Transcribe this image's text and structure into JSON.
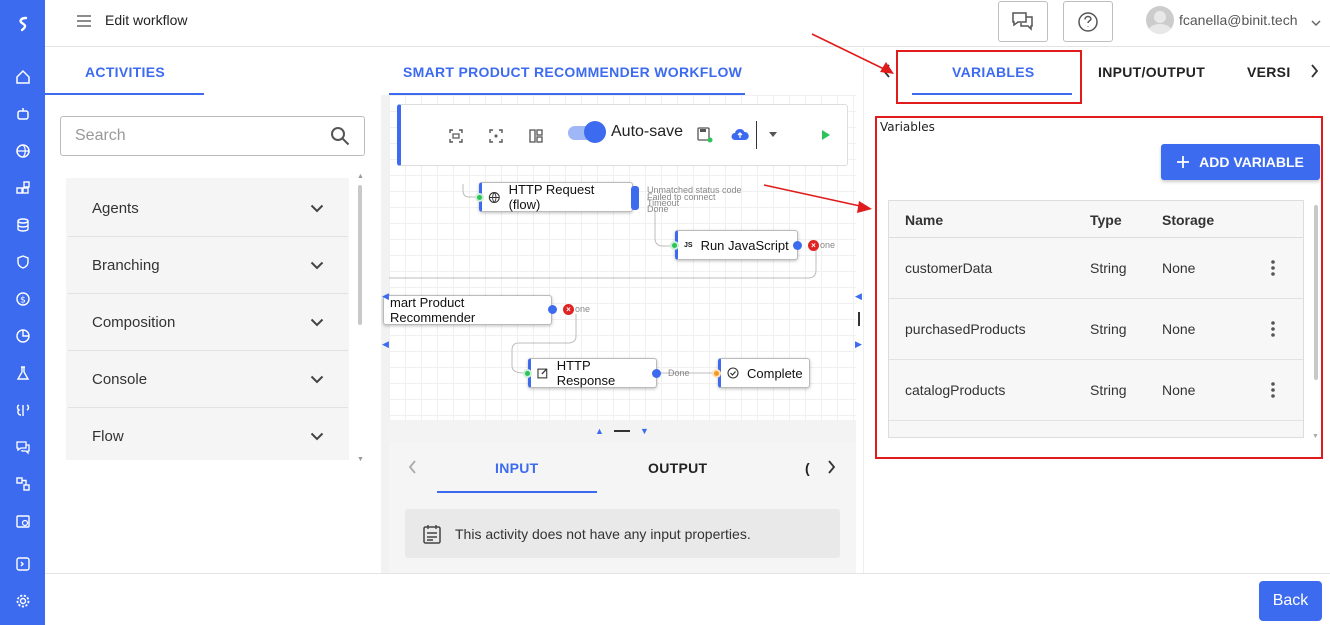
{
  "header": {
    "title": "Edit workflow",
    "user": "fcanella@binit.tech"
  },
  "left": {
    "tab": "ACTIVITIES",
    "search_placeholder": "Search",
    "categories": [
      "Agents",
      "Branching",
      "Composition",
      "Console",
      "Flow"
    ]
  },
  "canvas": {
    "tab": "SMART PRODUCT RECOMMENDER WORKFLOW",
    "autosave_label": "Auto-save",
    "nodes": {
      "http_request": "HTTP Request (flow)",
      "run_js": "Run JavaScript",
      "recommender": "mart Product Recommender",
      "http_response": "HTTP Response",
      "complete": "Complete"
    },
    "outcomes": {
      "unmatched": "Unmatched status code",
      "failed": "Failed to connect",
      "timeout": "Timeout",
      "done": "Done",
      "js_done": "one",
      "rec_done": "one",
      "resp_done": "Done"
    }
  },
  "bottom": {
    "tabs": [
      "INPUT",
      "OUTPUT"
    ],
    "active": "INPUT",
    "message": "This activity does not have any input properties."
  },
  "right": {
    "tabs": [
      "VARIABLES",
      "INPUT/OUTPUT",
      "VERSI"
    ],
    "active": "VARIABLES",
    "section_label": "Variables",
    "add_label": "ADD VARIABLE",
    "columns": [
      "Name",
      "Type",
      "Storage"
    ],
    "rows": [
      {
        "name": "customerData",
        "type": "String",
        "storage": "None"
      },
      {
        "name": "purchasedProducts",
        "type": "String",
        "storage": "None"
      },
      {
        "name": "catalogProducts",
        "type": "String",
        "storage": "None"
      }
    ]
  },
  "footer": {
    "back": "Back"
  },
  "colors": {
    "accent": "#3d6bf0",
    "annotation": "#e01b1b"
  }
}
